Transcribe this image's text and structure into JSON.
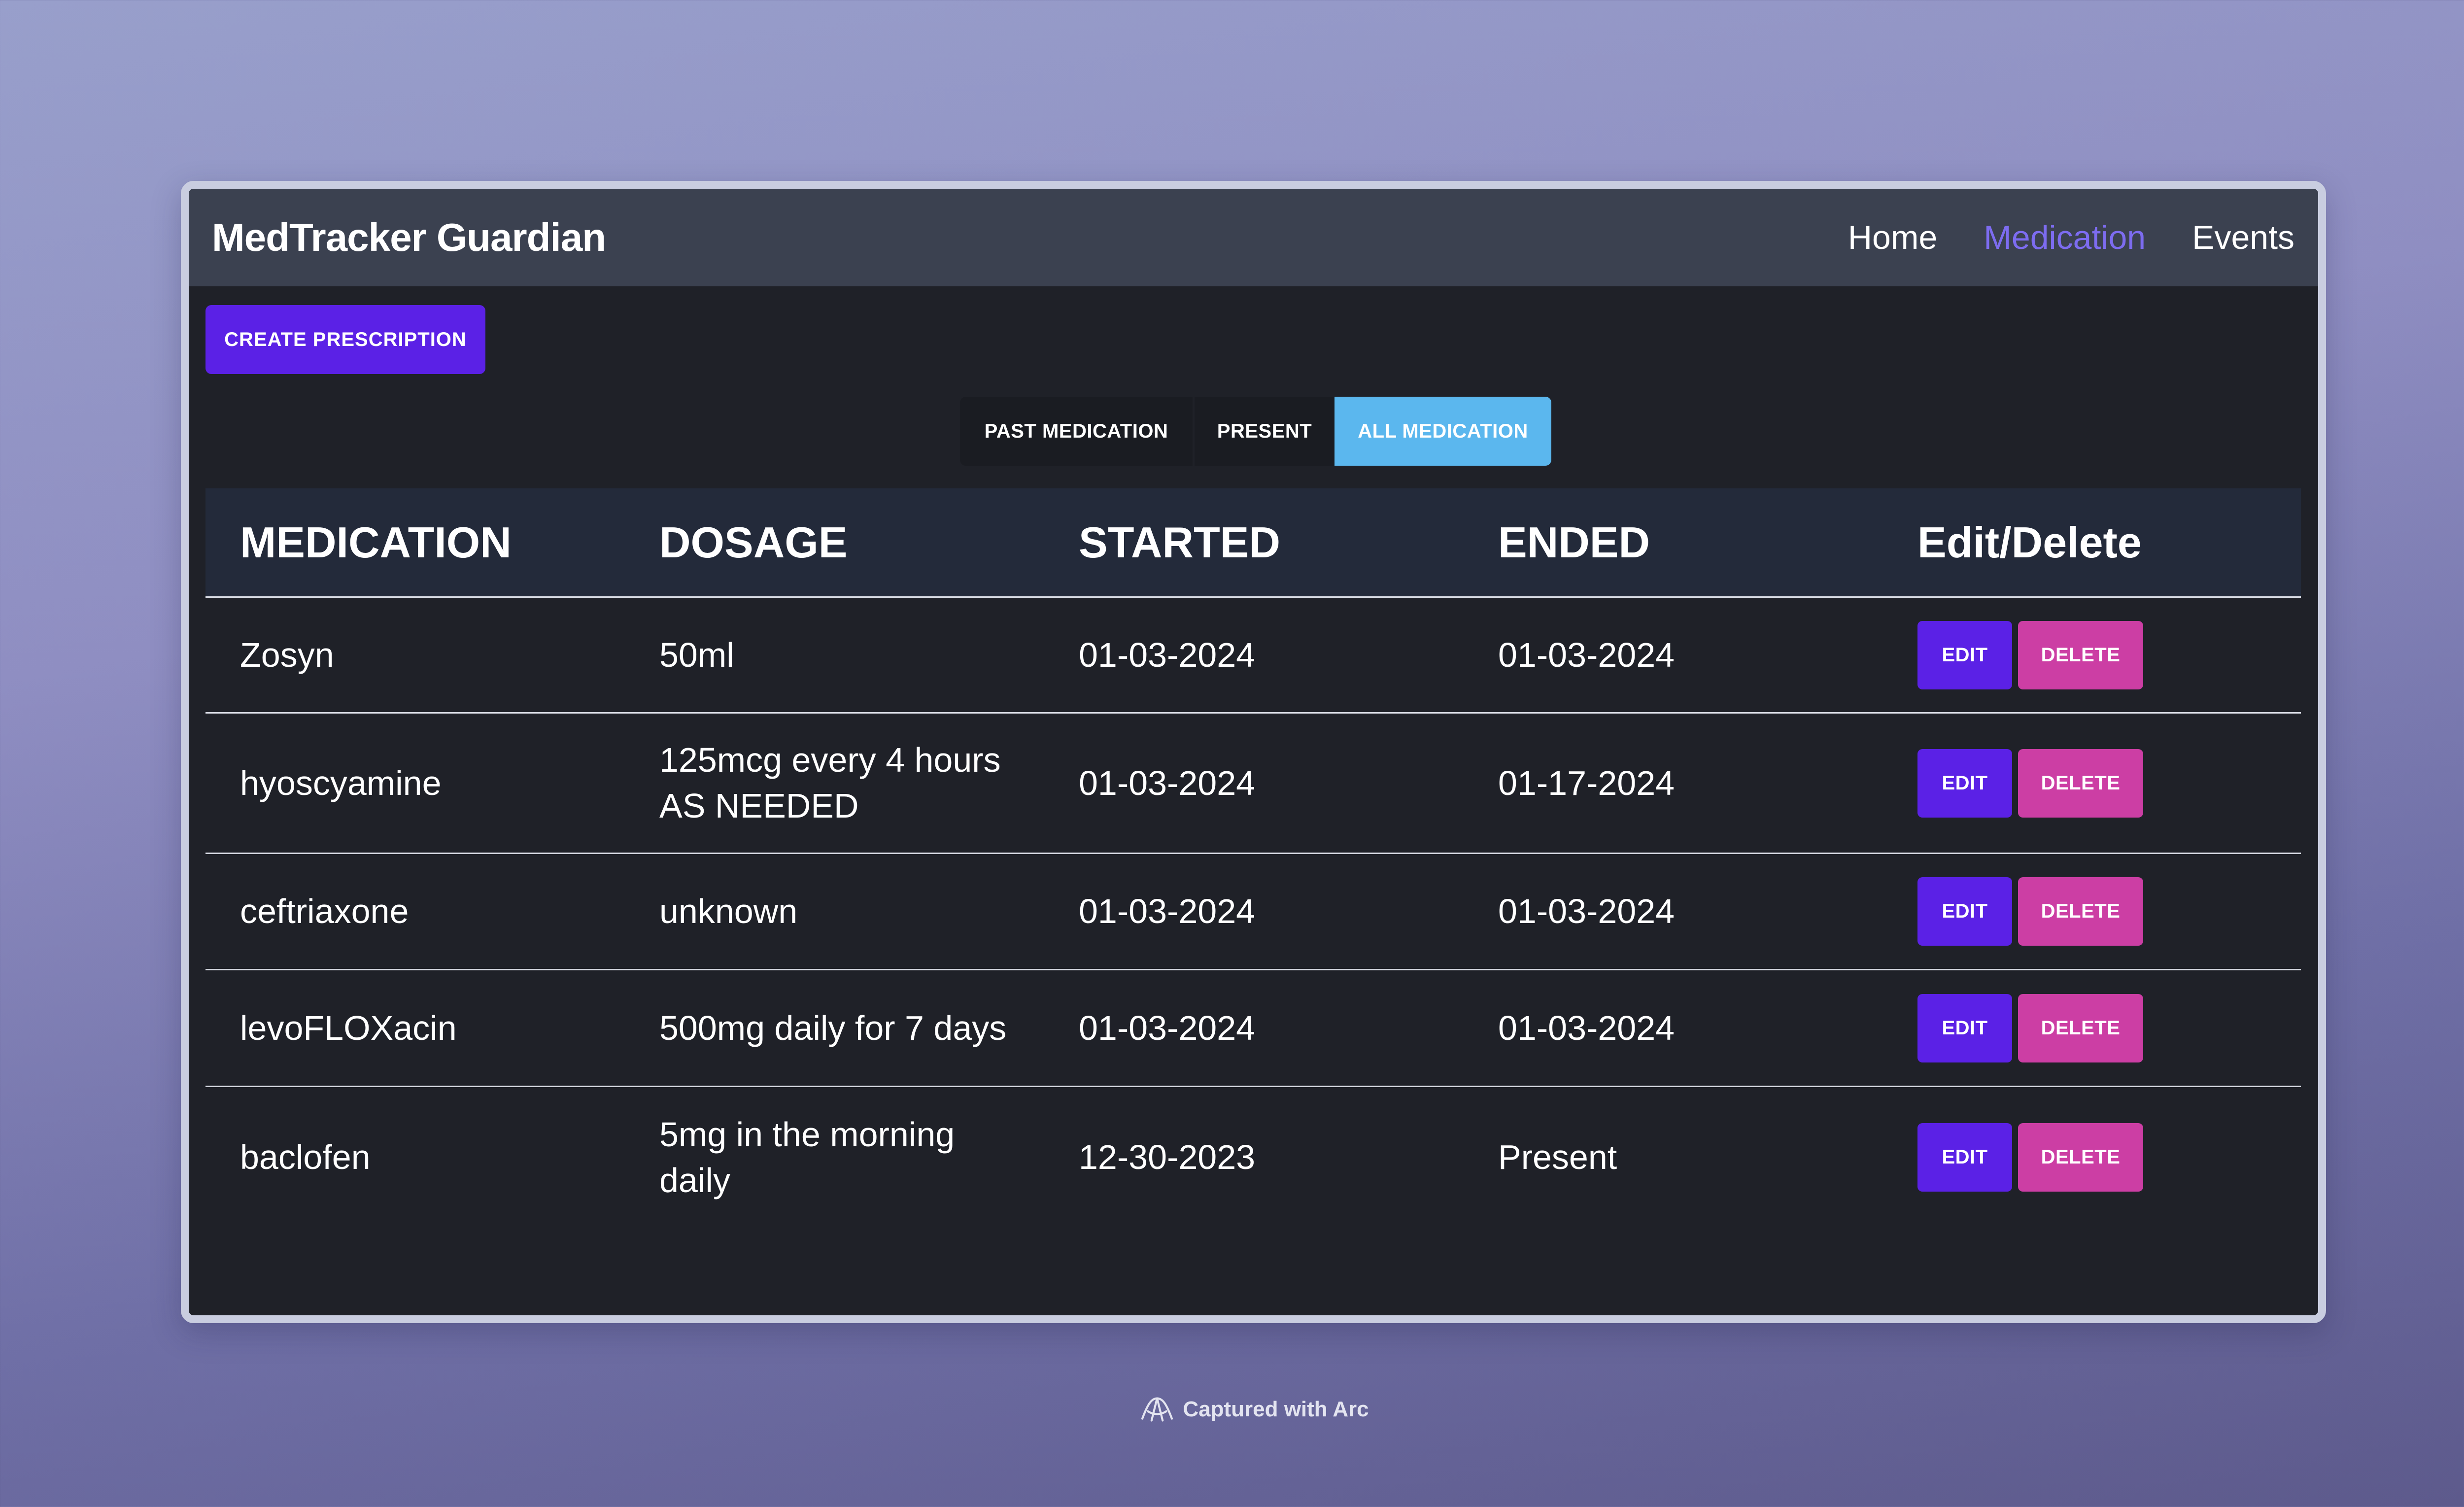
{
  "navbar": {
    "brand": "MedTracker Guardian",
    "links": [
      {
        "label": "Home",
        "active": false
      },
      {
        "label": "Medication",
        "active": true
      },
      {
        "label": "Events",
        "active": false
      }
    ]
  },
  "actions": {
    "create_label": "CREATE PRESCRIPTION"
  },
  "filters": [
    {
      "label": "PAST MEDICATION",
      "selected": false
    },
    {
      "label": "PRESENT",
      "selected": false
    },
    {
      "label": "ALL MEDICATION",
      "selected": true
    }
  ],
  "table": {
    "headers": [
      "MEDICATION",
      "DOSAGE",
      "STARTED",
      "ENDED",
      "Edit/Delete"
    ],
    "edit_label": "EDIT",
    "delete_label": "DELETE",
    "rows": [
      {
        "medication": "Zosyn",
        "dosage": "50ml",
        "started": "01-03-2024",
        "ended": "01-03-2024"
      },
      {
        "medication": "hyoscyamine",
        "dosage": "125mcg every 4 hours AS NEEDED",
        "started": "01-03-2024",
        "ended": "01-17-2024"
      },
      {
        "medication": "ceftriaxone",
        "dosage": "unknown",
        "started": "01-03-2024",
        "ended": "01-03-2024"
      },
      {
        "medication": "levoFLOXacin",
        "dosage": "500mg daily for 7 days",
        "started": "01-03-2024",
        "ended": "01-03-2024"
      },
      {
        "medication": "baclofen",
        "dosage": "5mg in the morning daily",
        "started": "12-30-2023",
        "ended": "Present"
      }
    ]
  },
  "footer": {
    "text": "Captured with Arc"
  },
  "colors": {
    "primary": "#5b21e6",
    "danger": "#cc3ea4",
    "active_filter": "#5bb7ee",
    "nav_active": "#7d6cf0"
  }
}
